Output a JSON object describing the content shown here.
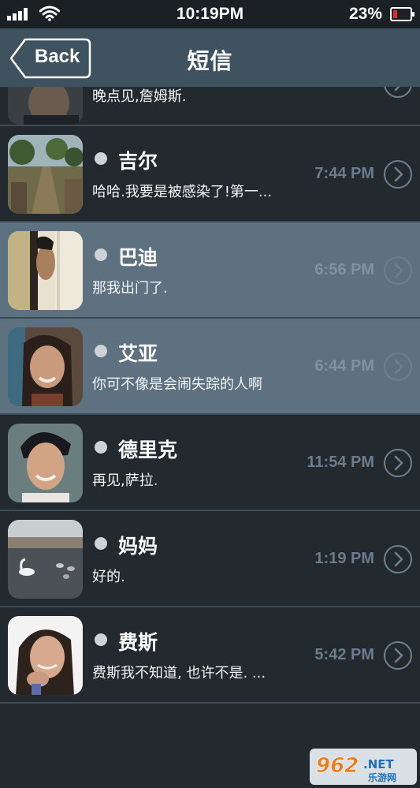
{
  "status_bar": {
    "time": "10:19PM",
    "battery_percent": "23%",
    "battery_level": 0.23,
    "battery_color": "#e22b2b"
  },
  "nav": {
    "back_label": "Back",
    "title": "短信"
  },
  "conversations": [
    {
      "name": "",
      "preview": "晚点见,詹姆斯.",
      "time": "",
      "avatar_icon": "man-avatar",
      "highlighted": false
    },
    {
      "name": "吉尔",
      "preview": "哈哈.我要是被感染了!第一...",
      "time": "7:44 PM",
      "avatar_icon": "landscape-avatar",
      "highlighted": false
    },
    {
      "name": "巴迪",
      "preview": "那我出门了.",
      "time": "6:56 PM",
      "avatar_icon": "peeking-man-avatar",
      "highlighted": true
    },
    {
      "name": "艾亚",
      "preview": "你可不像是会闹失踪的人啊",
      "time": "6:44 PM",
      "avatar_icon": "woman-avatar",
      "highlighted": true
    },
    {
      "name": "德里克",
      "preview": "再见,萨拉.",
      "time": "11:54 PM",
      "avatar_icon": "young-man-avatar",
      "highlighted": false
    },
    {
      "name": "妈妈",
      "preview": "好的.",
      "time": "1:19 PM",
      "avatar_icon": "lake-swan-avatar",
      "highlighted": false
    },
    {
      "name": "费斯",
      "preview": "费斯我不知道, 也许不是. ...",
      "time": "5:42 PM",
      "avatar_icon": "laughing-woman-avatar",
      "highlighted": false
    }
  ],
  "watermark": {
    "brand": "962",
    "suffix": ".NET",
    "caption": "乐游网"
  },
  "colors": {
    "nav_bg": "#3f5260",
    "list_bg": "#222a30",
    "highlight_bg": "#5d7181",
    "time_text": "#6b7d8a"
  }
}
